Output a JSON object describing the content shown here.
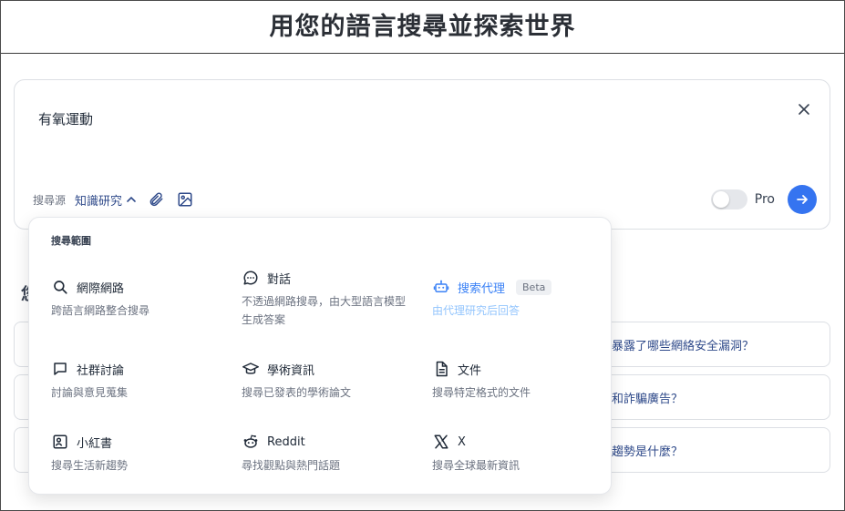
{
  "page": {
    "title": "用您的語言搜尋並探索世界"
  },
  "search": {
    "query": "有氧運動",
    "source_label": "搜尋源",
    "mode_label": "知識研究",
    "pro_label": "Pro",
    "pro_enabled": false
  },
  "suggestions": [
    {
      "text": "暴露了哪些網絡安全漏洞？"
    },
    {
      "text": "和詐騙廣告？"
    },
    {
      "text": "趨勢是什麼？"
    }
  ],
  "background_heading": "您",
  "dropdown": {
    "header": "搜尋範圍",
    "options": [
      {
        "name": "網際網路",
        "desc": "跨語言網路整合搜尋",
        "icon": "search-icon"
      },
      {
        "name": "對話",
        "desc": "不透過網路搜尋，由大型語言模型生成答案",
        "icon": "chat-bubble-icon"
      },
      {
        "name": "搜索代理",
        "desc": "由代理研究后回答",
        "icon": "robot-icon",
        "badge": "Beta",
        "highlighted": true
      },
      {
        "name": "社群討論",
        "desc": "討論與意見蒐集",
        "icon": "message-square-icon"
      },
      {
        "name": "學術資訊",
        "desc": "搜尋已發表的學術論文",
        "icon": "graduation-cap-icon"
      },
      {
        "name": "文件",
        "desc": "搜尋特定格式的文件",
        "icon": "file-icon"
      },
      {
        "name": "小紅書",
        "desc": "搜尋生活新趨勢",
        "icon": "image-square-icon"
      },
      {
        "name": "Reddit",
        "desc": "尋找觀點與熱門話題",
        "icon": "reddit-icon"
      },
      {
        "name": "X",
        "desc": "搜尋全球最新資訊",
        "icon": "x-logo-icon"
      }
    ]
  },
  "colors": {
    "accent": "#3574f0",
    "link": "#2f4a8a",
    "highlight": "#3b82f6"
  }
}
